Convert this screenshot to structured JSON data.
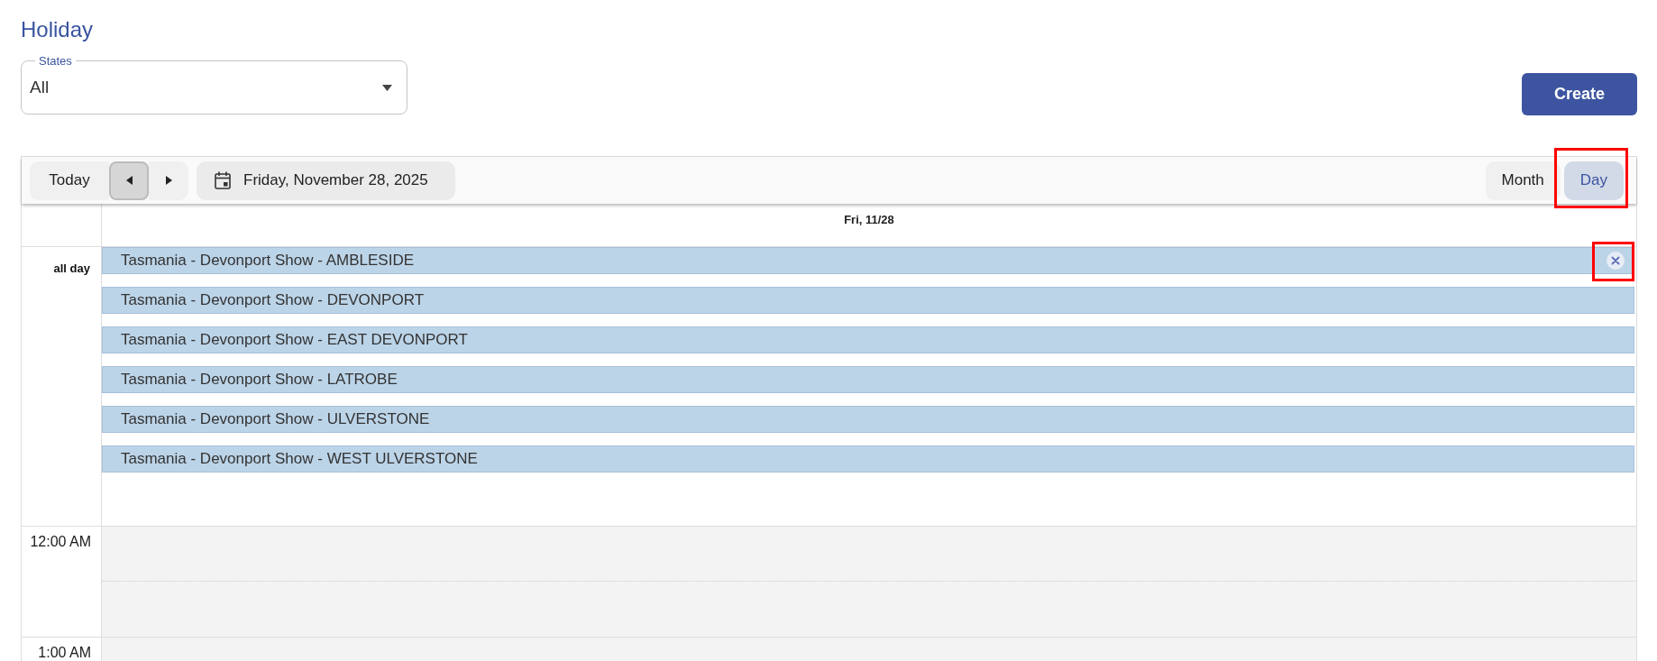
{
  "page": {
    "title": "Holiday"
  },
  "filter": {
    "label": "States",
    "value": "All"
  },
  "actions": {
    "create": "Create"
  },
  "toolbar": {
    "today": "Today",
    "nav": [
      {
        "kind": "prev",
        "pressed": true
      },
      {
        "kind": "next",
        "pressed": false
      }
    ],
    "date": "Friday, November 28, 2025",
    "views": [
      {
        "label": "Month",
        "selected": false,
        "highlighted": false
      },
      {
        "label": "Day",
        "selected": true,
        "highlighted": true
      }
    ]
  },
  "day_view": {
    "column_header": "Fri, 11/28",
    "all_day_label": "all day",
    "events": [
      {
        "title": "Tasmania - Devonport Show - AMBLESIDE",
        "remove_visible": true,
        "highlighted": true
      },
      {
        "title": "Tasmania - Devonport Show - DEVONPORT",
        "remove_visible": false,
        "highlighted": false
      },
      {
        "title": "Tasmania - Devonport Show - EAST DEVONPORT",
        "remove_visible": false,
        "highlighted": false
      },
      {
        "title": "Tasmania - Devonport Show - LATROBE",
        "remove_visible": false,
        "highlighted": false
      },
      {
        "title": "Tasmania - Devonport Show - ULVERSTONE",
        "remove_visible": false,
        "highlighted": false
      },
      {
        "title": "Tasmania - Devonport Show - WEST ULVERSTONE",
        "remove_visible": false,
        "highlighted": false
      }
    ],
    "time_slots": [
      {
        "label": "12:00 AM"
      },
      {
        "label": "1:00 AM"
      }
    ]
  }
}
